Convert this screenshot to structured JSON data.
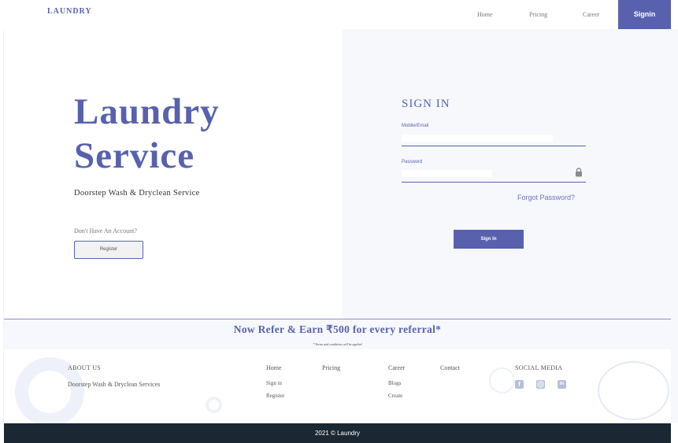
{
  "nav": {
    "brand": "LAUNDRY",
    "links": [
      "Home",
      "Pricing",
      "Career"
    ],
    "signin": "Signin"
  },
  "hero": {
    "title_line1": "Laundry",
    "title_line2": "Service",
    "subtitle": "Doorstep Wash & Dryclean Service",
    "no_account": "Don't Have An Account?",
    "register": "Register"
  },
  "signin_form": {
    "title": "SIGN IN",
    "mobile_label": "Mobile/Email",
    "password_label": "Password",
    "forgot": "Forgot Password?",
    "submit": "Sign In",
    "lock_icon": "lock-icon"
  },
  "referral": {
    "title": "Now Refer & Earn ₹500 for every referral*",
    "note": "* Terms and conditions will be applied"
  },
  "footer": {
    "about_heading": "ABOUT US",
    "about_text": "Doorstep Wash & Dryclean Services",
    "home": "Home",
    "signin": "Sign in",
    "register": "Register",
    "pricing": "Pricing",
    "career": "Career",
    "blogs": "Blogs",
    "create": "Create",
    "contact": "Contact",
    "social_heading": "SOCIAL MEDIA",
    "social_icons": [
      "facebook-icon",
      "instagram-icon",
      "linkedin-icon"
    ],
    "copyright": "2021 © Laundry"
  },
  "colors": {
    "primary": "#5861ae",
    "panel_bg": "#f7f8fc",
    "footer_bar": "#1b2733"
  }
}
